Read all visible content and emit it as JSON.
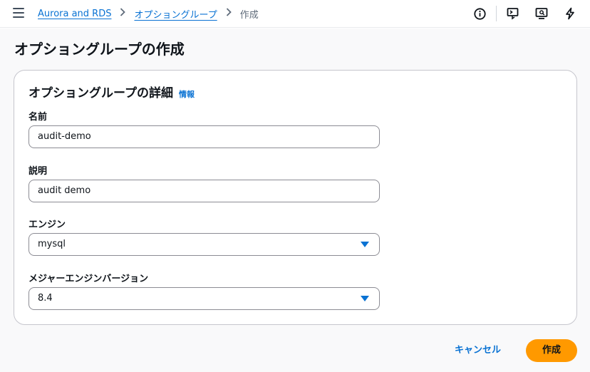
{
  "breadcrumb": {
    "items": [
      {
        "label": "Aurora and RDS"
      },
      {
        "label": "オプショングループ"
      },
      {
        "label": "作成"
      }
    ]
  },
  "header_icons": [
    "menu-icon",
    "info-icon",
    "cloudshell-icon",
    "monitor-icon",
    "lightning-icon"
  ],
  "page": {
    "title": "オプショングループの作成"
  },
  "panel": {
    "title": "オプショングループの詳細",
    "info_link": "情報",
    "fields": {
      "name": {
        "label": "名前",
        "value": "audit-demo"
      },
      "description": {
        "label": "説明",
        "value": "audit demo"
      },
      "engine": {
        "label": "エンジン",
        "value": "mysql"
      },
      "major_version": {
        "label": "メジャーエンジンバージョン",
        "value": "8.4"
      }
    }
  },
  "actions": {
    "cancel_label": "キャンセル",
    "create_label": "作成"
  },
  "colors": {
    "link": "#0972d3",
    "primary_button": "#ff9900",
    "page_background": "#f9f9fa"
  }
}
